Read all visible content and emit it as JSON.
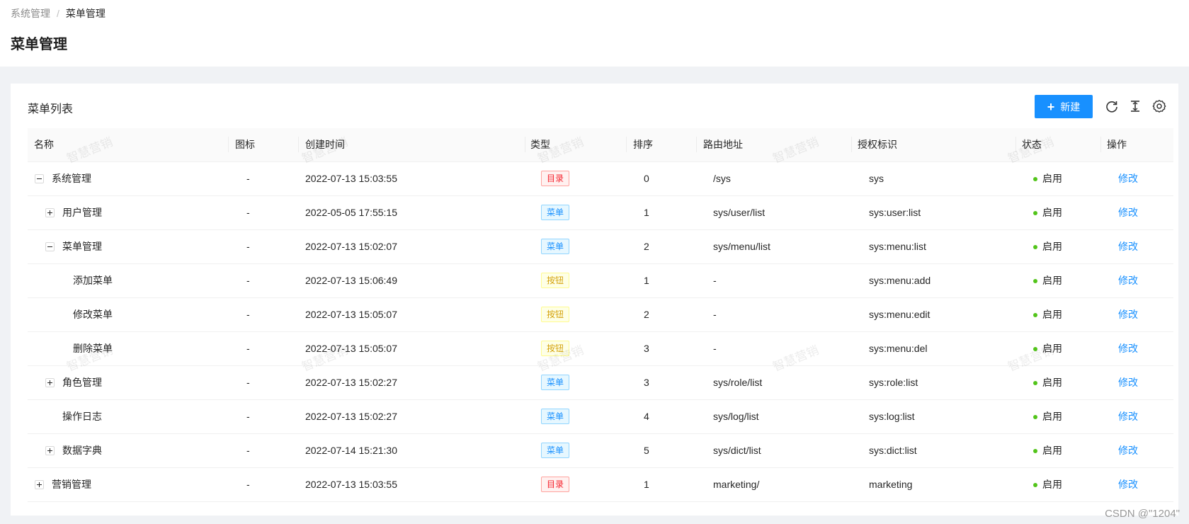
{
  "breadcrumb": {
    "parent": "系统管理",
    "separator": "/",
    "current": "菜单管理"
  },
  "page": {
    "title": "菜单管理"
  },
  "card": {
    "title": "菜单列表",
    "new_button": "新建",
    "toolbar_icons": [
      "reload-icon",
      "density-icon",
      "settings-icon"
    ]
  },
  "table": {
    "columns": [
      "名称",
      "图标",
      "创建时间",
      "类型",
      "排序",
      "路由地址",
      "授权标识",
      "状态",
      "操作"
    ],
    "rows": [
      {
        "name": "系统管理",
        "icon": "-",
        "created": "2022-07-13 15:03:55",
        "type": "目录",
        "sort": "0",
        "route": "/sys",
        "perm": "sys",
        "status": "启用",
        "action": "修改"
      },
      {
        "name": "用户管理",
        "icon": "-",
        "created": "2022-05-05 17:55:15",
        "type": "菜单",
        "sort": "1",
        "route": "sys/user/list",
        "perm": "sys:user:list",
        "status": "启用",
        "action": "修改"
      },
      {
        "name": "菜单管理",
        "icon": "-",
        "created": "2022-07-13 15:02:07",
        "type": "菜单",
        "sort": "2",
        "route": "sys/menu/list",
        "perm": "sys:menu:list",
        "status": "启用",
        "action": "修改"
      },
      {
        "name": "添加菜单",
        "icon": "-",
        "created": "2022-07-13 15:06:49",
        "type": "按钮",
        "sort": "1",
        "route": "-",
        "perm": "sys:menu:add",
        "status": "启用",
        "action": "修改"
      },
      {
        "name": "修改菜单",
        "icon": "-",
        "created": "2022-07-13 15:05:07",
        "type": "按钮",
        "sort": "2",
        "route": "-",
        "perm": "sys:menu:edit",
        "status": "启用",
        "action": "修改"
      },
      {
        "name": "删除菜单",
        "icon": "-",
        "created": "2022-07-13 15:05:07",
        "type": "按钮",
        "sort": "3",
        "route": "-",
        "perm": "sys:menu:del",
        "status": "启用",
        "action": "修改"
      },
      {
        "name": "角色管理",
        "icon": "-",
        "created": "2022-07-13 15:02:27",
        "type": "菜单",
        "sort": "3",
        "route": "sys/role/list",
        "perm": "sys:role:list",
        "status": "启用",
        "action": "修改"
      },
      {
        "name": "操作日志",
        "icon": "-",
        "created": "2022-07-13 15:02:27",
        "type": "菜单",
        "sort": "4",
        "route": "sys/log/list",
        "perm": "sys:log:list",
        "status": "启用",
        "action": "修改"
      },
      {
        "name": "数据字典",
        "icon": "-",
        "created": "2022-07-14 15:21:30",
        "type": "菜单",
        "sort": "5",
        "route": "sys/dict/list",
        "perm": "sys:dict:list",
        "status": "启用",
        "action": "修改"
      },
      {
        "name": "营销管理",
        "icon": "-",
        "created": "2022-07-13 15:03:55",
        "type": "目录",
        "sort": "1",
        "route": "marketing/",
        "perm": "marketing",
        "status": "启用",
        "action": "修改"
      }
    ]
  },
  "tag_colors": {
    "目录": "#f5222d",
    "菜单": "#1890ff",
    "按钮": "#d4a20b"
  },
  "status_color": "#52c41a",
  "watermark_text": "智慧营销",
  "footer_mark": "CSDN @\"1204\""
}
